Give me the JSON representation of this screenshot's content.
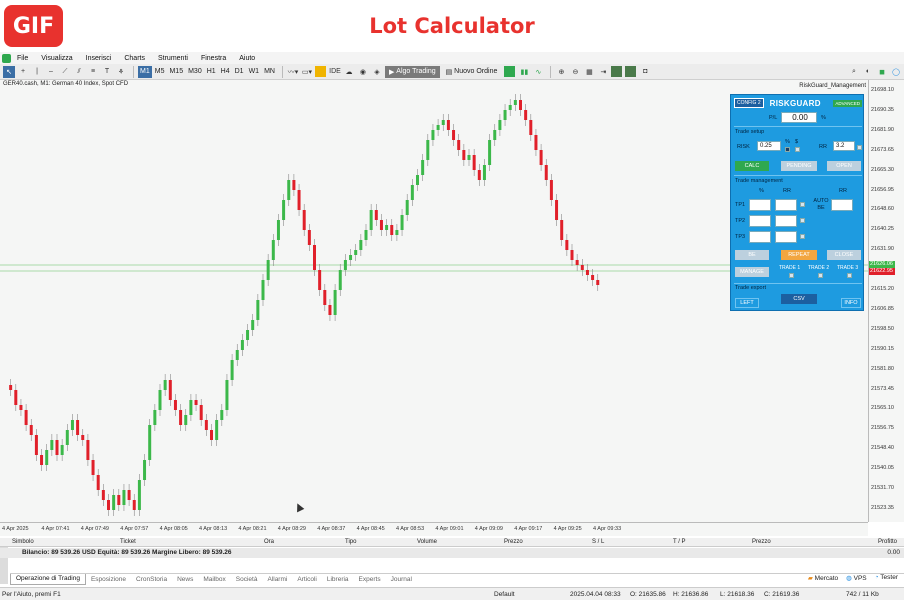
{
  "banner": {
    "badge": "GIF",
    "title": "Lot Calculator"
  },
  "menu": [
    "File",
    "Visualizza",
    "Inserisci",
    "Charts",
    "Strumenti",
    "Finestra",
    "Aiuto"
  ],
  "toolbar": {
    "timeframes": [
      "M1",
      "M5",
      "M15",
      "M30",
      "H1",
      "H4",
      "D1",
      "W1",
      "MN"
    ],
    "selected_timeframe": "M1",
    "ide_label": "IDE",
    "algo_label": "Algo Trading",
    "order_label": "Nuovo Ordine"
  },
  "chart": {
    "label": "GER40.cash, M1:  German 40 Index, Spot CFD",
    "indicator": "RiskGuard_Management",
    "price_ticks": [
      "21698.10",
      "21690.35",
      "21681.90",
      "21673.65",
      "21665.30",
      "21656.95",
      "21648.60",
      "21640.25",
      "21631.90",
      "21623.55",
      "21615.20",
      "21606.85",
      "21598.50",
      "21590.15",
      "21581.80",
      "21573.45",
      "21565.10",
      "21556.75",
      "21548.40",
      "21540.05",
      "21531.70",
      "21523.35"
    ],
    "price_tag_green": "21626.06",
    "price_tag_red": "21622.95",
    "time_ticks": [
      "4 Apr 2025",
      "4 Apr 07:41",
      "4 Apr 07:49",
      "4 Apr 07:57",
      "4 Apr 08:05",
      "4 Apr 08:13",
      "4 Apr 08:21",
      "4 Apr 08:29",
      "4 Apr 08:37",
      "4 Apr 08:45",
      "4 Apr 08:53",
      "4 Apr 09:01",
      "4 Apr 09:09",
      "4 Apr 09:17",
      "4 Apr 09:25",
      "4 Apr 09:33"
    ],
    "colors": {
      "up": "#3cb84a",
      "down": "#e0202a",
      "bg": "#f5f6f5"
    }
  },
  "riskguard": {
    "config": "CONFIG 2",
    "title": "RISKGUARD",
    "advanced": "ADVANCED",
    "pl_label": "P/L",
    "pl_value": "0.00",
    "pl_unit": "%",
    "trade_setup": "Trade setup",
    "risk_label": "RISK",
    "risk_value": "0.25",
    "risk_unit_pct": "%",
    "risk_unit_cur": "$",
    "rr_label": "RR",
    "rr_value": "3.2",
    "calc": "CALC",
    "pending": "PENDING",
    "open": "OPEN",
    "trade_management": "Trade management",
    "col_pct": "%",
    "col_rr": "RR",
    "col_rr2": "RR",
    "auto_be": "AUTO BE",
    "tp1": "TP1",
    "tp2": "TP2",
    "tp3": "TP3",
    "be": "BE",
    "repeat": "REPEAT",
    "close": "CLOSE",
    "manage": "MANAGE",
    "trade1": "TRADE 1",
    "trade2": "TRADE 2",
    "trade3": "TRADE 3",
    "trade_export": "Trade export",
    "left": "LEFT",
    "csv": "CSV",
    "info": "INFO"
  },
  "terminal": {
    "headers": [
      "Simbolo",
      "Ticket",
      "Ora",
      "Tipo",
      "Volume",
      "Prezzo",
      "S / L",
      "T / P",
      "Prezzo",
      "Profitto"
    ],
    "balance_text": "Bilancio: 89 539.26 USD  Equità: 89 539.26  Margine Libero: 89 539.26",
    "balance_value": "0.00",
    "tabs": [
      "Operazione di Trading",
      "Esposizione",
      "CronStoria",
      "News",
      "Mailbox",
      "Società",
      "Allarmi",
      "Articoli",
      "Libreria",
      "Experts",
      "Journal"
    ],
    "right_items": [
      "Mercato",
      "VPS",
      "Tester"
    ]
  },
  "status": {
    "help": "Per l'Aiuto, premi F1",
    "profile": "Default",
    "datetime": "2025.04.04 08:33",
    "open": "O: 21635.86",
    "high": "H: 21636.86",
    "low": "L: 21618.36",
    "close": "C: 21619.36",
    "traffic": "742 / 11 Kb"
  }
}
